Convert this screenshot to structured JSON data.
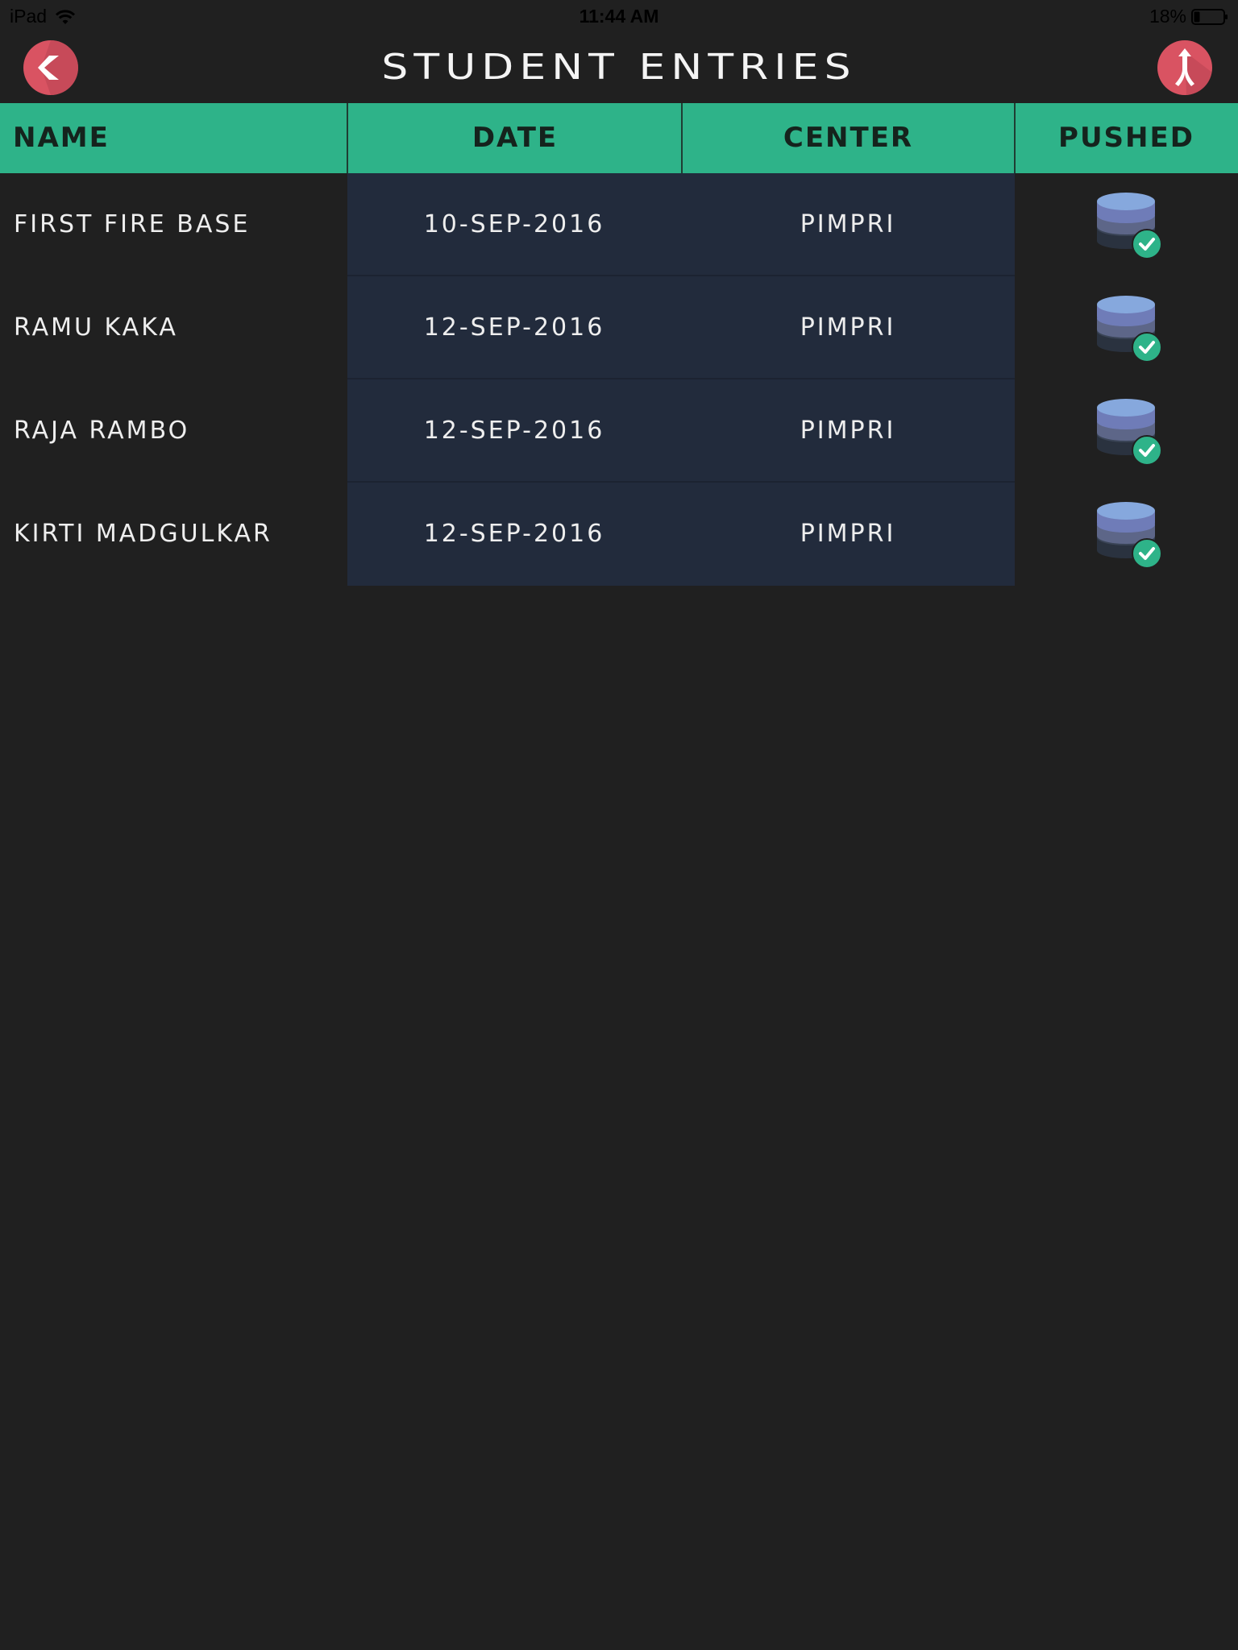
{
  "status_bar": {
    "device": "iPad",
    "time": "11:44 AM",
    "battery": "18%"
  },
  "header": {
    "title": "STUDENT ENTRIES",
    "back_icon": "back-chevron-icon",
    "push_icon": "merge-arrow-icon"
  },
  "table": {
    "columns": [
      "NAME",
      "DATE",
      "CENTER",
      "PUSHED"
    ],
    "rows": [
      {
        "name": "FIRST FIRE BASE",
        "date": "10-SEP-2016",
        "center": "PIMPRI",
        "pushed": true
      },
      {
        "name": "RAMU KAKA",
        "date": "12-SEP-2016",
        "center": "PIMPRI",
        "pushed": true
      },
      {
        "name": "RAJA RAMBO",
        "date": "12-SEP-2016",
        "center": "PIMPRI",
        "pushed": true
      },
      {
        "name": "KIRTI MADGULKAR",
        "date": "12-SEP-2016",
        "center": "PIMPRI",
        "pushed": true
      }
    ],
    "pushed_icon": "database-check-icon"
  },
  "colors": {
    "background": "#202020",
    "header_green": "#2eb389",
    "accent_red": "#d95362",
    "row_mid_bg": "#222b3c",
    "check_green": "#2eb389"
  }
}
